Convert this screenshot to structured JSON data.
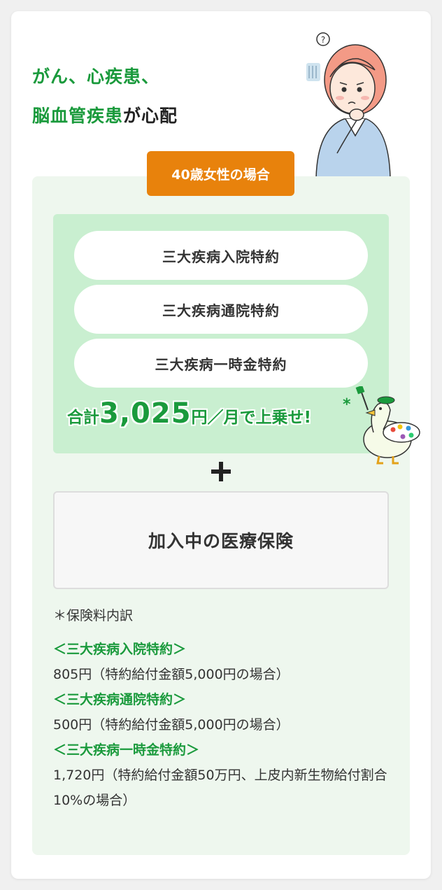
{
  "header": {
    "line1": "がん、心疾患、",
    "line2_green": "脳血管疾患",
    "line2_black": "が心配"
  },
  "badge": {
    "label": "40歳女性の場合"
  },
  "riders": [
    {
      "label": "三大疾病入院特約"
    },
    {
      "label": "三大疾病通院特約"
    },
    {
      "label": "三大疾病一時金特約"
    }
  ],
  "total": {
    "prefix": "合計",
    "amount": "3,025",
    "unit": "円",
    "suffix": "／月で上乗せ!",
    "asterisk": "*"
  },
  "plus_symbol": "+",
  "current_insurance": {
    "label": "加入中の医療保険"
  },
  "breakdown": {
    "title": "＊保険料内訳",
    "items": [
      {
        "label": "＜三大疾病入院特約＞",
        "value": "805円（特約給付金額5,000円の場合）"
      },
      {
        "label": "＜三大疾病通院特約＞",
        "value": "500円（特約給付金額5,000円の場合）"
      },
      {
        "label": "＜三大疾病一時金特約＞",
        "value": "1,720円（特約給付金額50万円、上皮内新生物給付割合10%の場合）"
      }
    ]
  },
  "colors": {
    "green": "#1a9a3c",
    "orange": "#e8820c",
    "rider_bg": "#c9efd0",
    "panel_bg": "#eef7ee"
  },
  "icons": [
    "worried-woman-illustration",
    "goose-mascot-illustration",
    "plus-icon"
  ]
}
